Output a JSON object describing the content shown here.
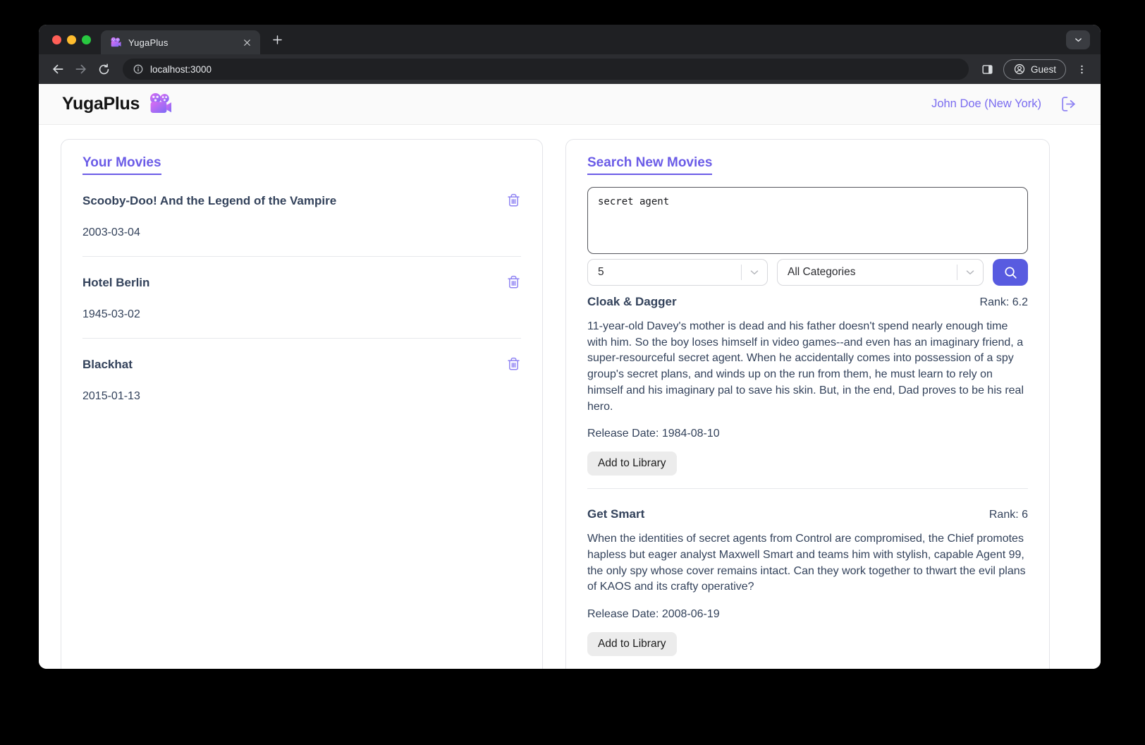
{
  "browser": {
    "tab_title": "YugaPlus",
    "url": "localhost:3000",
    "guest_label": "Guest"
  },
  "header": {
    "brand": "YugaPlus",
    "user": "John Doe (New York)"
  },
  "library": {
    "title": "Your Movies",
    "movies": [
      {
        "title": "Scooby-Doo! And the Legend of the Vampire",
        "date": "2003-03-04"
      },
      {
        "title": "Hotel Berlin",
        "date": "1945-03-02"
      },
      {
        "title": "Blackhat",
        "date": "2015-01-13"
      }
    ]
  },
  "search": {
    "title": "Search New Movies",
    "query": "secret agent",
    "limit_value": "5",
    "category_value": "All Categories",
    "results": [
      {
        "title": "Cloak & Dagger",
        "rank": "Rank: 6.2",
        "description": "11-year-old Davey's mother is dead and his father doesn't spend nearly enough time with him. So the boy loses himself in video games--and even has an imaginary friend, a super-resourceful secret agent. When he accidentally comes into possession of a spy group's secret plans, and winds up on the run from them, he must learn to rely on himself and his imaginary pal to save his skin. But, in the end, Dad proves to be his real hero.",
        "release": "Release Date: 1984-08-10",
        "action": "Add to Library"
      },
      {
        "title": "Get Smart",
        "rank": "Rank: 6",
        "description": "When the identities of secret agents from Control are compromised, the Chief promotes hapless but eager analyst Maxwell Smart and teams him with stylish, capable Agent 99, the only spy whose cover remains intact. Can they work together to thwart the evil plans of KAOS and its crafty operative?",
        "release": "Release Date: 2008-06-19",
        "action": "Add to Library"
      }
    ]
  },
  "icons": {
    "favicon": "movie-camera",
    "brand_logo": "movie-camera",
    "user_action": "logout-door-arrow",
    "movie_row_action": "trash-can",
    "search_submit": "magnifier",
    "profile_chip": "person-circle",
    "address_bar": "info-circle"
  },
  "colors": {
    "accent_purple": "#6b5ce7",
    "accent_purple_light": "#8f83f3",
    "search_button_bg": "#585be0",
    "text_navy": "#33425b",
    "traffic_red": "#ff5f57",
    "traffic_yellow": "#febc2e",
    "traffic_green": "#28c840"
  }
}
